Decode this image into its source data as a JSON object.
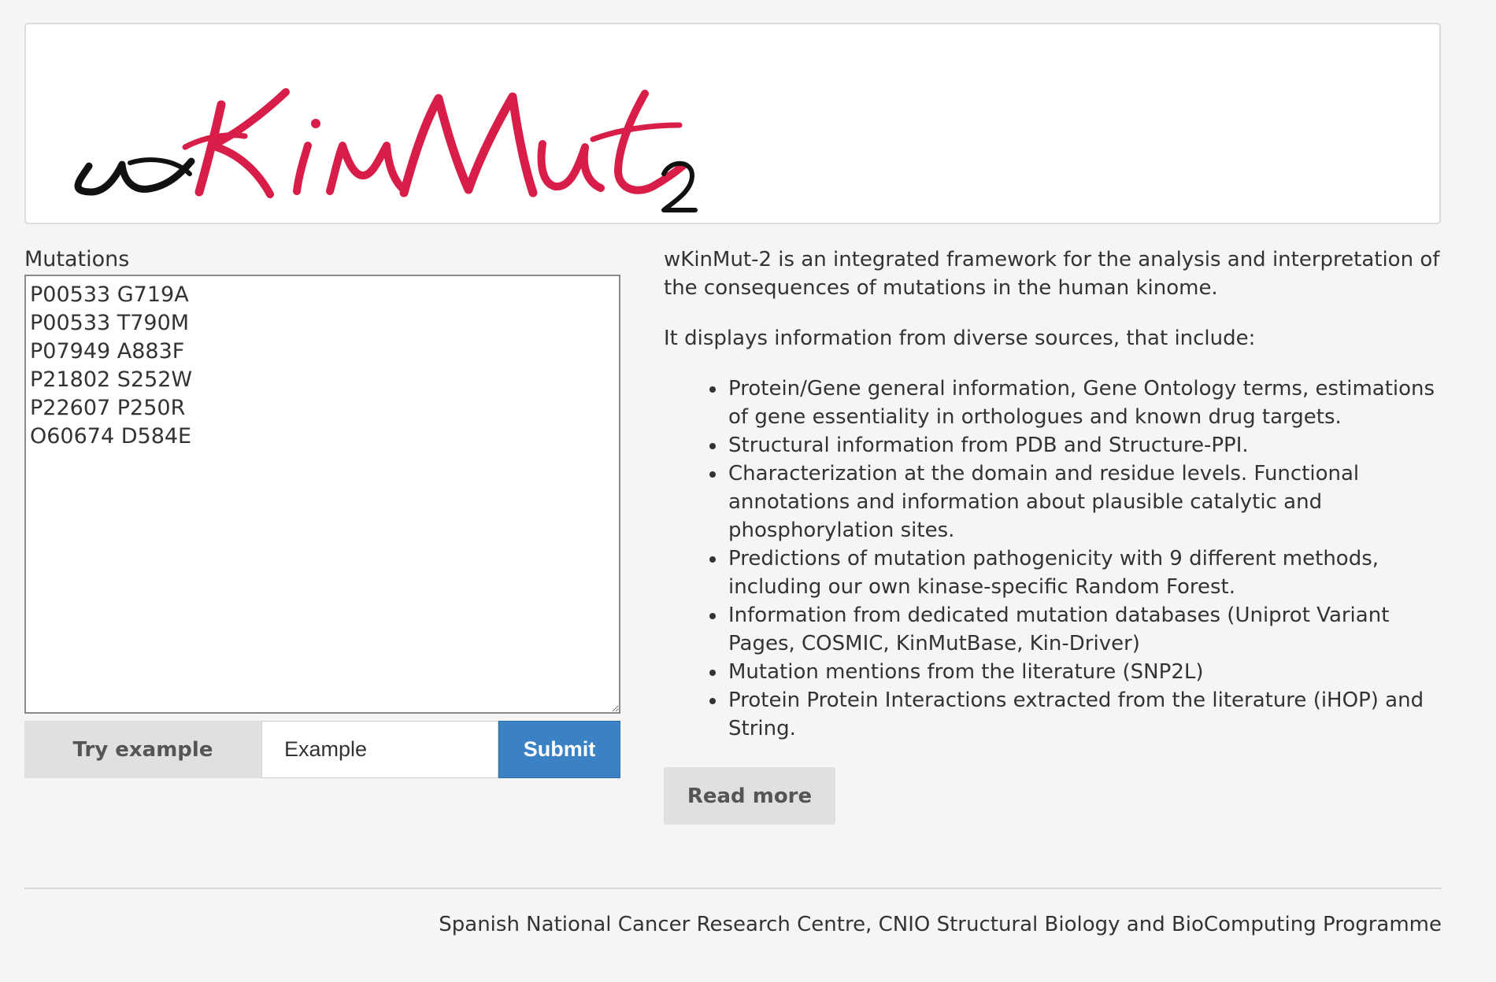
{
  "header": {
    "logo_text": "wKinMut2"
  },
  "form": {
    "mutations_label": "Mutations",
    "mutations_value": "P00533 G719A\nP00533 T790M\nP07949 A883F\nP21802 S252W\nP22607 P250R\nO60674 D584E",
    "try_example_label": "Try example",
    "example_value": "Example",
    "submit_label": "Submit"
  },
  "description": {
    "intro": "wKinMut-2 is an integrated framework for the analysis and interpretation of the consequences of mutations in the human kinome.",
    "sources_intro": "It displays information from diverse sources, that include:",
    "sources": [
      "Protein/Gene general information, Gene Ontology terms, estimations of gene essentiality in orthologues and known drug targets.",
      "Structural information from PDB and Structure-PPI.",
      "Characterization at the domain and residue levels. Functional annotations and information about plausible catalytic and phosphorylation sites.",
      "Predictions of mutation pathogenicity with 9 different methods, including our own kinase-specific Random Forest.",
      "Information from dedicated mutation databases (Uniprot Variant Pages, COSMIC, KinMutBase, Kin-Driver)",
      "Mutation mentions from the literature (SNP2L)",
      "Protein Protein Interactions extracted from the literature (iHOP) and String."
    ],
    "read_more_label": "Read more"
  },
  "footer": {
    "text": "Spanish National Cancer Research Centre, CNIO Structural Biology and BioComputing Programme"
  },
  "colors": {
    "logo_red": "#d81e48",
    "logo_black": "#111111",
    "submit_blue": "#3b82c4",
    "page_background": "#f5f5f5"
  }
}
